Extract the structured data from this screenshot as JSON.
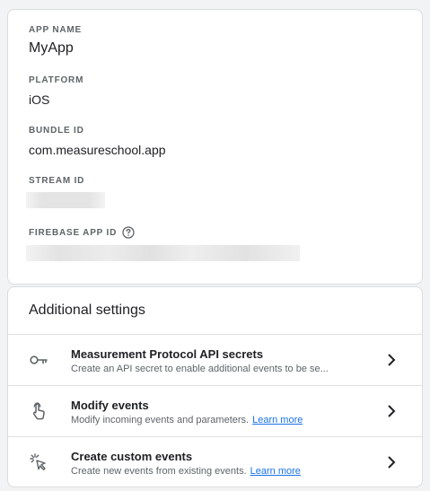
{
  "details": {
    "app_name_label": "APP NAME",
    "app_name": "MyApp",
    "platform_label": "PLATFORM",
    "platform": "iOS",
    "bundle_id_label": "BUNDLE ID",
    "bundle_id": "com.measureschool.app",
    "stream_id_label": "STREAM ID",
    "firebase_app_id_label": "FIREBASE APP ID"
  },
  "settings": {
    "title": "Additional settings",
    "items": [
      {
        "title": "Measurement Protocol API secrets",
        "description": "Create an API secret to enable additional events to be se...",
        "icon": "key-icon"
      },
      {
        "title": "Modify events",
        "description": "Modify incoming events and parameters.",
        "link": "Learn more",
        "icon": "touch-icon"
      },
      {
        "title": "Create custom events",
        "description": "Create new events from existing events.",
        "link": "Learn more",
        "icon": "sparkle-cursor-icon"
      }
    ]
  },
  "colors": {
    "link": "#1a73e8",
    "label": "#5f6368",
    "text": "#202124"
  }
}
